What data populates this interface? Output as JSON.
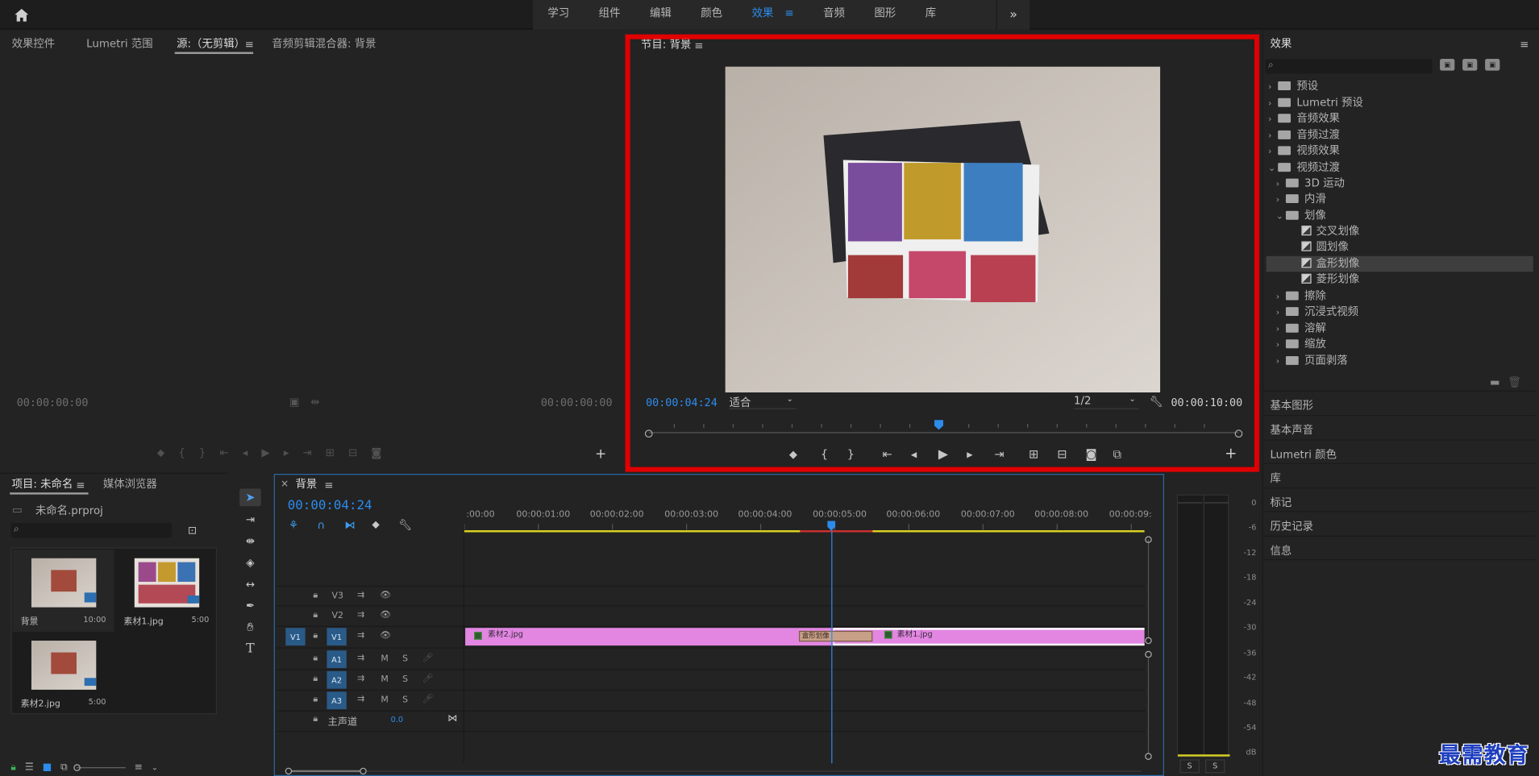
{
  "workspaces": [
    "学习",
    "组件",
    "编辑",
    "颜色",
    "效果",
    "音频",
    "图形",
    "库"
  ],
  "workspace_active": "效果",
  "source_tabs": {
    "effect_controls": "效果控件",
    "lumetri_scopes": "Lumetri 范围",
    "source": "源:（无剪辑）",
    "audio_mixer": "音频剪辑混合器: 背景"
  },
  "source_tc_left": "00:00:00:00",
  "source_tc_right": "00:00:00:00",
  "program": {
    "title": "节目: 背景",
    "tc_current": "00:00:04:24",
    "fit": "适合",
    "quality": "1/2",
    "tc_duration": "00:00:10:00"
  },
  "effects": {
    "title": "效果",
    "search_placeholder": "",
    "tree": [
      {
        "label": "预设",
        "depth": 0,
        "kind": "preset",
        "open": false
      },
      {
        "label": "Lumetri 预设",
        "depth": 0,
        "kind": "preset",
        "open": false
      },
      {
        "label": "音频效果",
        "depth": 0,
        "kind": "folder",
        "open": false
      },
      {
        "label": "音频过渡",
        "depth": 0,
        "kind": "folder",
        "open": false
      },
      {
        "label": "视频效果",
        "depth": 0,
        "kind": "folder",
        "open": false
      },
      {
        "label": "视频过渡",
        "depth": 0,
        "kind": "folder",
        "open": true
      },
      {
        "label": "3D 运动",
        "depth": 1,
        "kind": "folder",
        "open": false
      },
      {
        "label": "内滑",
        "depth": 1,
        "kind": "folder",
        "open": false
      },
      {
        "label": "划像",
        "depth": 1,
        "kind": "folder",
        "open": true
      },
      {
        "label": "交叉划像",
        "depth": 2,
        "kind": "fx"
      },
      {
        "label": "圆划像",
        "depth": 2,
        "kind": "fx"
      },
      {
        "label": "盒形划像",
        "depth": 2,
        "kind": "fx",
        "selected": true
      },
      {
        "label": "菱形划像",
        "depth": 2,
        "kind": "fx"
      },
      {
        "label": "擦除",
        "depth": 1,
        "kind": "folder",
        "open": false
      },
      {
        "label": "沉浸式视频",
        "depth": 1,
        "kind": "folder",
        "open": false
      },
      {
        "label": "溶解",
        "depth": 1,
        "kind": "folder",
        "open": false
      },
      {
        "label": "缩放",
        "depth": 1,
        "kind": "folder",
        "open": false
      },
      {
        "label": "页面剥落",
        "depth": 1,
        "kind": "folder",
        "open": false
      }
    ],
    "sections": [
      "基本图形",
      "基本声音",
      "Lumetri 颜色",
      "库",
      "标记",
      "历史记录",
      "信息"
    ]
  },
  "project": {
    "tab": "项目: 未命名",
    "media_tab": "媒体浏览器",
    "file": "未命名.prproj",
    "items": [
      {
        "name": "背景",
        "duration": "10:00"
      },
      {
        "name": "素材1.jpg",
        "duration": "5:00"
      },
      {
        "name": "素材2.jpg",
        "duration": "5:00"
      }
    ]
  },
  "timeline": {
    "tab": "背景",
    "tc": "00:00:04:24",
    "ruler": [
      ":00:00",
      "00:00:01:00",
      "00:00:02:00",
      "00:00:03:00",
      "00:00:04:00",
      "00:00:05:00",
      "00:00:06:00",
      "00:00:07:00",
      "00:00:08:00",
      "00:00:09:"
    ],
    "tracks": {
      "v3": "V3",
      "v2": "V2",
      "v1": "V1",
      "a1": "A1",
      "a2": "A2",
      "a3": "A3"
    },
    "source_patch": "V1",
    "mute": "M",
    "solo": "S",
    "master": "主声道",
    "master_val": "0.0",
    "clip1": "素材2.jpg",
    "clip2": "素材1.jpg",
    "transition": "盒形划像"
  },
  "meter": {
    "scale": [
      "0",
      "-6",
      "-12",
      "-18",
      "-24",
      "-30",
      "-36",
      "-42",
      "-48",
      "-54",
      "dB"
    ],
    "solo": [
      "S",
      "S"
    ]
  },
  "watermark": "最需教育",
  "colors": {
    "accent": "#2d8ceb",
    "clip": "#e286e2",
    "highlight_red": "#e00000"
  }
}
